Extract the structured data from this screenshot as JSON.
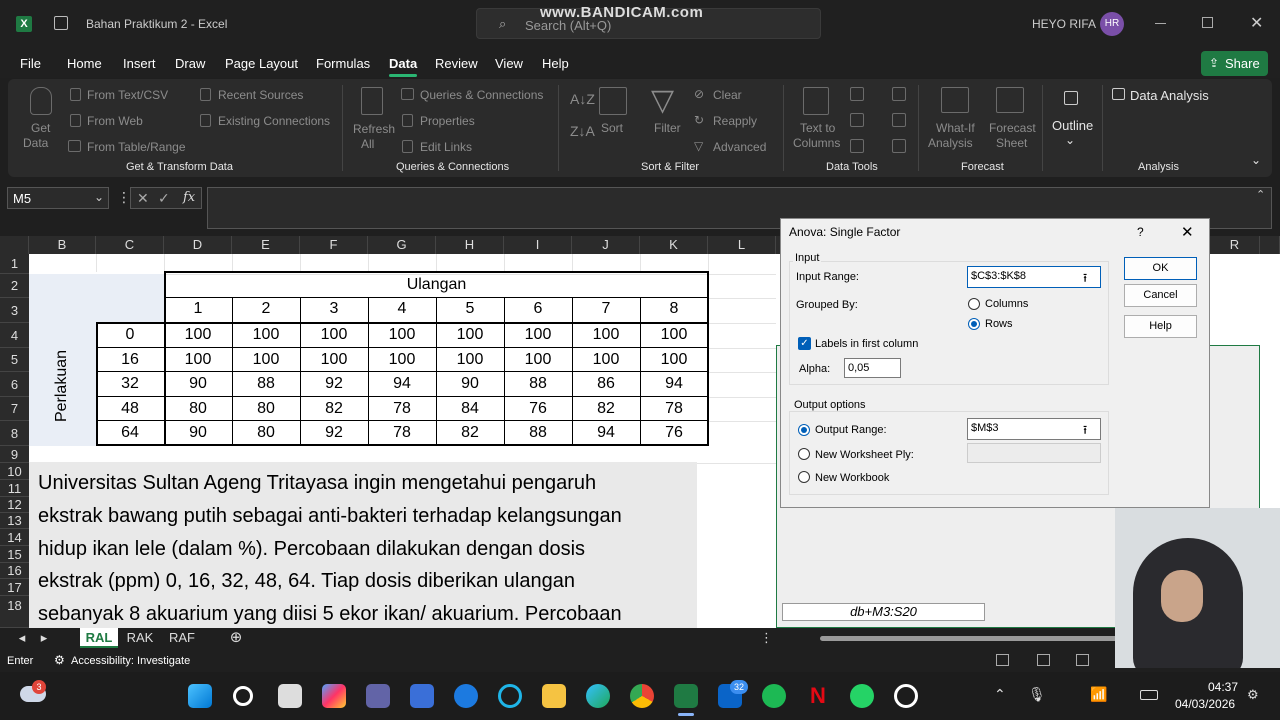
{
  "app": {
    "title": "Bahan Praktikum 2  -  Excel",
    "search_placeholder": "Search (Alt+Q)",
    "watermark": "www.BANDICAM.com",
    "user_name": "HEYO RIFA",
    "user_initials": "HR"
  },
  "menu": {
    "items": [
      "File",
      "Home",
      "Insert",
      "Draw",
      "Page Layout",
      "Formulas",
      "Data",
      "Review",
      "View",
      "Help"
    ],
    "active": "Data",
    "share_label": "Share"
  },
  "ribbon": {
    "get_data": "Get",
    "get_data2": "Data",
    "from_text": "From Text/CSV",
    "from_web": "From Web",
    "from_table": "From Table/Range",
    "recent_sources": "Recent Sources",
    "existing_connections": "Existing Connections",
    "refresh": "Refresh",
    "refresh2": "All",
    "queries_connections": "Queries & Connections",
    "properties": "Properties",
    "edit_links": "Edit Links",
    "sort": "Sort",
    "filter": "Filter",
    "clear": "Clear",
    "reapply": "Reapply",
    "advanced": "Advanced",
    "text_to_columns": "Text to",
    "text_to_columns2": "Columns",
    "what_if": "What-If",
    "what_if2": "Analysis",
    "forecast_sheet": "Forecast",
    "forecast_sheet2": "Sheet",
    "outline": "Outline",
    "data_analysis": "Data Analysis",
    "groups": [
      "Get & Transform Data",
      "Queries & Connections",
      "Sort & Filter",
      "Data Tools",
      "Forecast",
      "Analysis"
    ]
  },
  "formula_bar": {
    "name_box": "M5",
    "fx": "fx",
    "value": ""
  },
  "columns": [
    "B",
    "C",
    "D",
    "E",
    "F",
    "G",
    "H",
    "I",
    "J",
    "K",
    "L",
    "R"
  ],
  "rows": [
    "1",
    "2",
    "3",
    "4",
    "5",
    "6",
    "7",
    "8",
    "9",
    "10",
    "11",
    "12",
    "13",
    "14",
    "15",
    "16",
    "17",
    "18"
  ],
  "table": {
    "header_ulangan": "Ulangan",
    "perlakuan": "Perlakuan",
    "ulangan_numbers": [
      "1",
      "2",
      "3",
      "4",
      "5",
      "6",
      "7",
      "8"
    ],
    "dose": [
      "0",
      "16",
      "32",
      "48",
      "64"
    ],
    "values": [
      [
        "100",
        "100",
        "100",
        "100",
        "100",
        "100",
        "100",
        "100"
      ],
      [
        "100",
        "100",
        "100",
        "100",
        "100",
        "100",
        "100",
        "100"
      ],
      [
        "90",
        "88",
        "92",
        "94",
        "90",
        "88",
        "86",
        "94"
      ],
      [
        "80",
        "80",
        "82",
        "78",
        "84",
        "76",
        "82",
        "78"
      ],
      [
        "90",
        "80",
        "92",
        "78",
        "82",
        "88",
        "94",
        "76"
      ]
    ]
  },
  "textbox": {
    "lines": [
      "Universitas Sultan Ageng Tritayasa ingin mengetahui pengaruh",
      "ekstrak bawang putih sebagai anti-bakteri terhadap kelangsungan",
      "hidup ikan lele (dalam %). Percobaan dilakukan dengan dosis",
      "ekstrak (ppm) 0, 16, 32, 48, 64. Tiap dosis diberikan ulangan",
      "sebanyak 8 akuarium yang diisi 5 ekor ikan/ akuarium. Percobaan"
    ]
  },
  "dialog": {
    "title": "Anova: Single Factor",
    "help_q": "?",
    "input_section": "Input",
    "input_range_label": "Input Range:",
    "input_range_value": "$C$3:$K$8",
    "grouped_by_label": "Grouped By:",
    "columns_label": "Columns",
    "rows_label": "Rows",
    "grouped_by_selected": "Rows",
    "labels_first_column": "Labels in first column",
    "labels_checked": true,
    "alpha_label": "Alpha:",
    "alpha_value": "0,05",
    "output_section": "Output options",
    "output_range_label": "Output Range:",
    "output_range_value": "$M$3",
    "new_worksheet_label": "New Worksheet Ply:",
    "new_workbook_label": "New Workbook",
    "ok": "OK",
    "cancel": "Cancel",
    "help": "Help"
  },
  "sheet_tag": "db+M3:S20",
  "sheets": {
    "tabs": [
      "RAL",
      "RAK",
      "RAF"
    ],
    "active": "RAL"
  },
  "status": {
    "mode": "Enter",
    "accessibility": "Accessibility: Investigate"
  },
  "taskbar": {
    "time": "04:37",
    "date": "04/03/2026",
    "weather_badge": "3",
    "mail_badge": "32"
  }
}
